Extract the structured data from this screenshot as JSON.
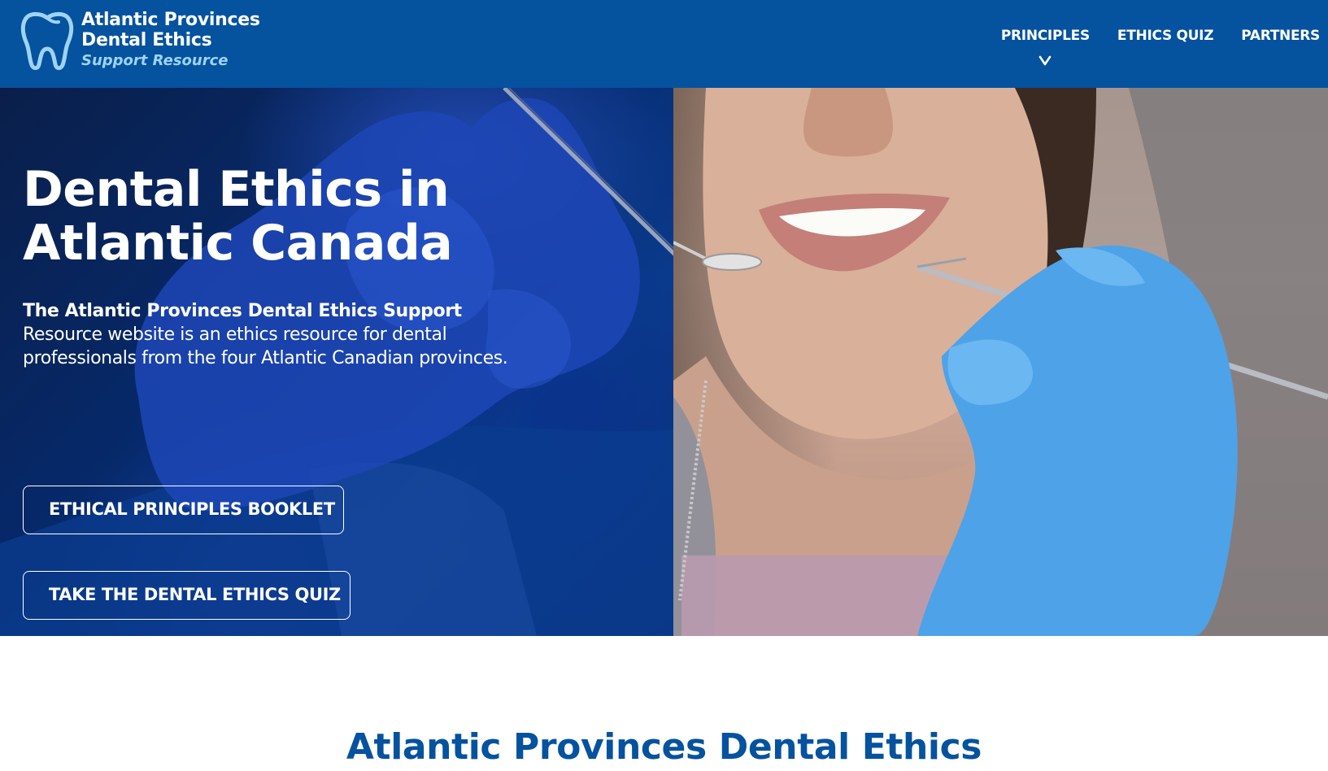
{
  "colors": {
    "brand_blue": "#05529f",
    "logo_subtitle": "#9ed3f5",
    "white": "#ffffff"
  },
  "header": {
    "logo": {
      "icon": "tooth-icon",
      "line1": "Atlantic Provinces",
      "line2": "Dental Ethics",
      "subtitle": "Support Resource"
    },
    "nav": [
      {
        "label": "PRINCIPLES",
        "has_dropdown": true,
        "dropdown_icon": "chevron-down-icon"
      },
      {
        "label": "ETHICS QUIZ",
        "has_dropdown": false
      },
      {
        "label": "PARTNERS",
        "has_dropdown": false
      }
    ]
  },
  "hero": {
    "title_line1": "Dental Ethics in",
    "title_line2": "Atlantic Canada",
    "description_bold": "The Atlantic Provinces Dental Ethics Support",
    "description_rest": " Resource website is an ethics resource for dental professionals from the four Atlantic Canadian provinces.",
    "buttons": [
      {
        "label": "ETHICAL PRINCIPLES BOOKLET"
      },
      {
        "label": "TAKE THE DENTAL ETHICS QUIZ"
      }
    ]
  },
  "section": {
    "title": "Atlantic Provinces Dental Ethics"
  }
}
